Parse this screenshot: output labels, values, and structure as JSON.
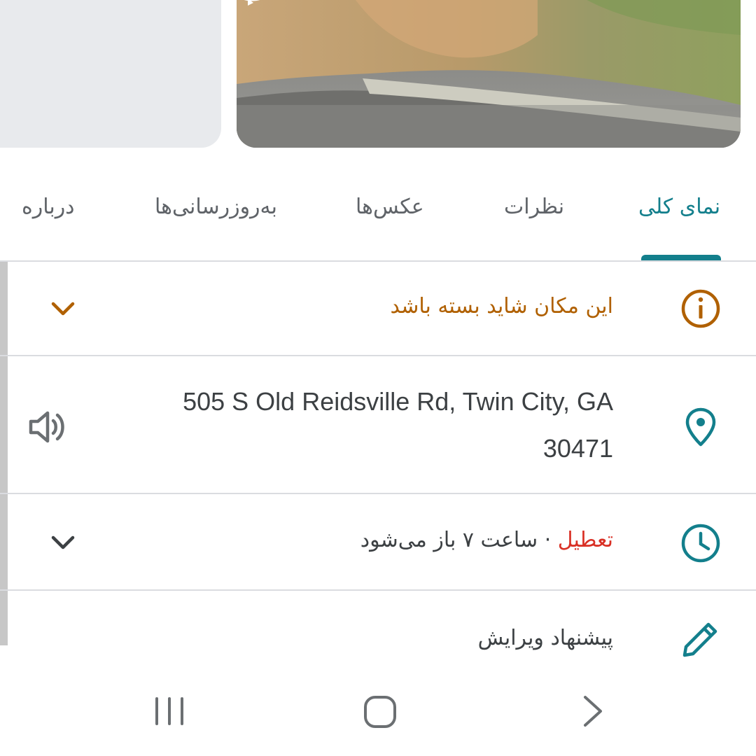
{
  "tabs": [
    {
      "label": "نمای کلی",
      "active": true
    },
    {
      "label": "نظرات",
      "active": false
    },
    {
      "label": "عکس‌ها",
      "active": false
    },
    {
      "label": "به‌روزرسانی‌ها",
      "active": false
    },
    {
      "label": "درباره",
      "active": false
    }
  ],
  "notice": {
    "text": "این مکان شاید بسته باشد",
    "icon": "info-icon"
  },
  "address": {
    "line1": "505 S Old Reidsville Rd, Twin City, GA",
    "line2": "30471",
    "icon": "location-pin-icon",
    "action_icon": "speaker-icon"
  },
  "hours": {
    "status": "تعطیل",
    "separator": " · ",
    "detail": "ساعت ۷ باز می‌شود",
    "icon": "clock-icon"
  },
  "edit": {
    "label": "پیشنهاد ویرایش",
    "icon": "pencil-icon"
  },
  "colors": {
    "accent": "#137f8c",
    "warning": "#b06000",
    "closed": "#d93025"
  }
}
